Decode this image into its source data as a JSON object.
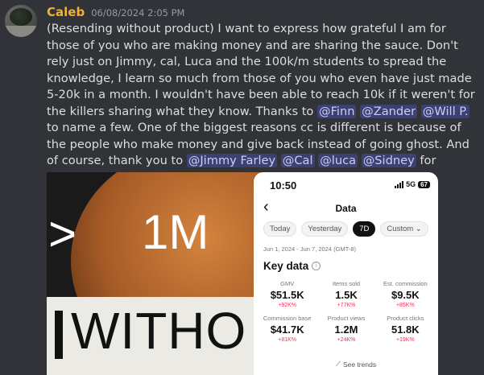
{
  "author": {
    "name": "Caleb",
    "timestamp": "06/08/2024 2:05 PM"
  },
  "message": {
    "t1": "(Resending without product) I want to express how grateful I am for those of you who are making money and are sharing the sauce. Don't rely just on Jimmy, cal, Luca and the 100k/m students to spread the knowledge, I learn so much from those of you who even have just made 5-20k in a month. I wouldn't have been able to reach 10k if it weren't for the killers sharing what they know. Thanks to",
    "m_finn": "@Finn",
    "m_zander": "@Zander",
    "m_willp": "@Will P.",
    "t2": "to name a few. One of the biggest reasons cc is different is because of the people who make money and give back instead of going ghost. And of course, thank you to",
    "m_jimmy": "@Jimmy Farley",
    "m_cal": "@Cal",
    "m_luca": "@luca",
    "m_sidney": "@Sidney",
    "t3": "for building such a thriving ecosystem. I love you guys"
  },
  "image_left": {
    "symbol": ">",
    "big_text": "1M",
    "bottom_text": "WITHO"
  },
  "phone": {
    "time": "10:50",
    "network": "5G",
    "battery": "67",
    "title": "Data",
    "tabs": [
      "Today",
      "Yesterday",
      "7D",
      "Custom"
    ],
    "active_tab": "7D",
    "date_range": "Jun 1, 2024 - Jun 7, 2024 (GMT-8)",
    "section_title": "Key data",
    "metrics": [
      {
        "label": "GMV",
        "value": "$51.5K",
        "change": "+92K%"
      },
      {
        "label": "Items sold",
        "value": "1.5K",
        "change": "+77K%"
      },
      {
        "label": "Est. commission",
        "value": "$9.5K",
        "change": "+85K%"
      },
      {
        "label": "Commission base",
        "value": "$41.7K",
        "change": "+81K%"
      },
      {
        "label": "Product views",
        "value": "1.2M",
        "change": "+24K%"
      },
      {
        "label": "Product clicks",
        "value": "51.8K",
        "change": "+19K%"
      }
    ],
    "see_trends": "See trends",
    "accent_color": "#fe2c55"
  },
  "colors": {
    "background": "#313338",
    "username": "#f0b232",
    "mention_bg": "#3c4270",
    "mention_text": "#c9cdfb"
  }
}
